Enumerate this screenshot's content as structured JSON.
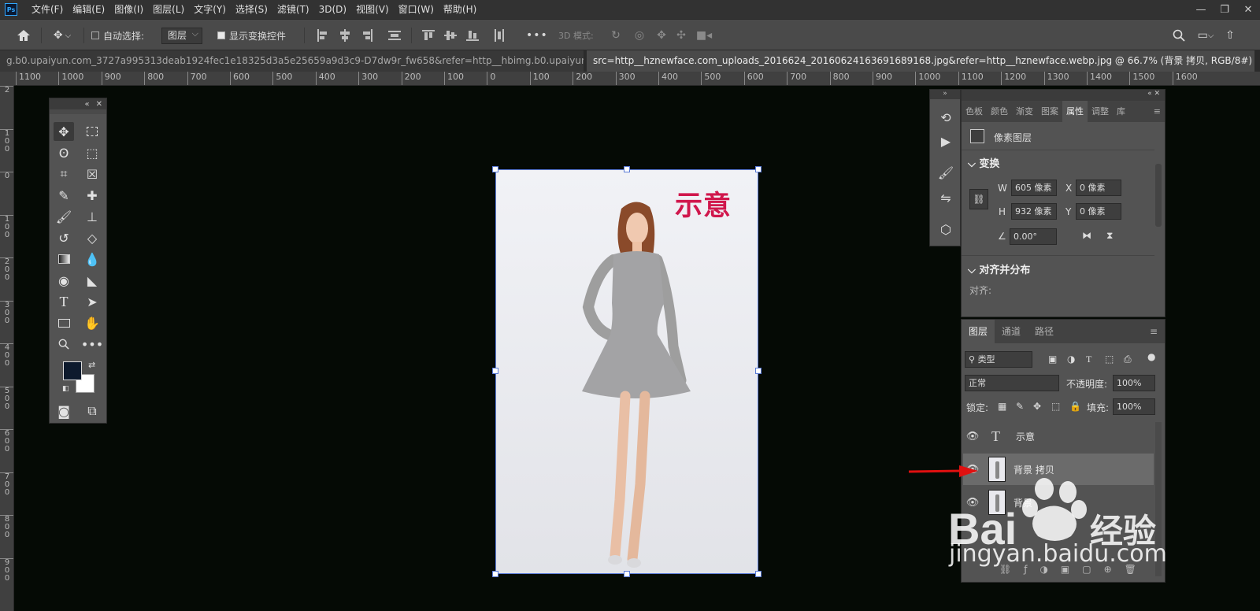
{
  "app": {
    "logo": "Ps"
  },
  "menu": [
    "文件(F)",
    "编辑(E)",
    "图像(I)",
    "图层(L)",
    "文字(Y)",
    "选择(S)",
    "滤镜(T)",
    "3D(D)",
    "视图(V)",
    "窗口(W)",
    "帮助(H)"
  ],
  "options": {
    "auto_select_label": "自动选择:",
    "auto_select_value": "图层",
    "show_transform_label": "显示变换控件",
    "more": "•••",
    "mode_3d_label": "3D 模式:"
  },
  "tabs": [
    {
      "label": "g.b0.upaiyun.com_3727a995313deab1924fec1e18325d3a5e25659a9d3c9-D7dw9r_fw658&refer=http__hbimg.b0.upaiyun.webp.jpg",
      "close": "×"
    },
    {
      "label": "src=http__hznewface.com_uploads_2016624_20160624163691689168.jpg&refer=http__hznewface.webp.jpg @ 66.7% (背景 拷贝, RGB/8#) *",
      "close": "×"
    }
  ],
  "ruler_h": [
    "1100",
    "1000",
    "900",
    "800",
    "700",
    "600",
    "500",
    "400",
    "300",
    "200",
    "100",
    "0",
    "100",
    "200",
    "300",
    "400",
    "500",
    "600",
    "700",
    "800",
    "900",
    "1000",
    "1100",
    "1200",
    "1300",
    "1400",
    "1500",
    "1600"
  ],
  "ruler_v": [
    "2",
    "1\n0\n0",
    "0",
    "1\n0\n0",
    "2\n0\n0",
    "3\n0\n0",
    "4\n0\n0",
    "5\n0\n0",
    "6\n0\n0",
    "7\n0\n0",
    "8\n0\n0",
    "9\n0\n0"
  ],
  "document": {
    "overlay_text": "示意"
  },
  "properties": {
    "tabs": [
      "色板",
      "颜色",
      "渐变",
      "图案",
      "属性",
      "调整",
      "库"
    ],
    "active_tab": "属性",
    "layer_type": "像素图层",
    "transform_title": "变换",
    "w_label": "W",
    "w_value": "605 像素",
    "h_label": "H",
    "h_value": "932 像素",
    "x_label": "X",
    "x_value": "0 像素",
    "y_label": "Y",
    "y_value": "0 像素",
    "angle_value": "0.00°",
    "align_title": "对齐并分布",
    "align_label": "对齐:"
  },
  "layers": {
    "tabs": [
      "图层",
      "通道",
      "路径"
    ],
    "filter_kind": "类型",
    "blend_mode": "正常",
    "opacity_label": "不透明度:",
    "opacity_value": "100%",
    "lock_label": "锁定:",
    "fill_label": "填充:",
    "fill_value": "100%",
    "items": [
      {
        "name": "示意",
        "type": "text"
      },
      {
        "name": "背景 拷贝",
        "type": "pixel",
        "selected": true
      },
      {
        "name": "背景",
        "type": "pixel"
      }
    ]
  },
  "watermark": {
    "brand": "Bai 经验",
    "url": "jingyan.baidu.com"
  },
  "colors": {
    "accent": "#31a8ff",
    "overlay_text": "#d0174c",
    "arrow": "#e01010"
  }
}
